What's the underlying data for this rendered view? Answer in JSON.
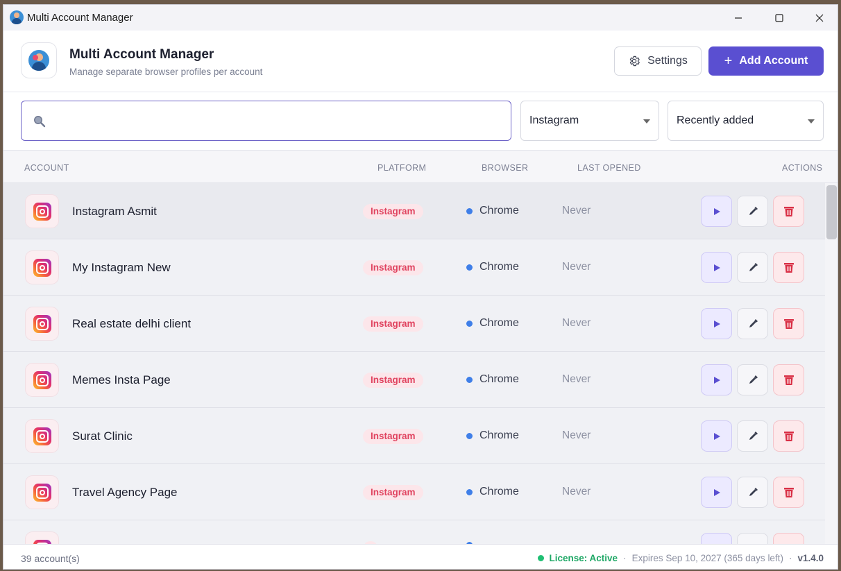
{
  "window": {
    "title": "Multi Account Manager"
  },
  "header": {
    "title": "Multi Account Manager",
    "subtitle": "Manage separate browser profiles per account",
    "settings_label": "Settings",
    "add_label": "Add Account",
    "add_icon": "+"
  },
  "filters": {
    "search_value": "",
    "platform": "Instagram",
    "sort": "Recently added"
  },
  "table": {
    "columns": [
      "ACCOUNT",
      "PLATFORM",
      "BROWSER",
      "LAST OPENED",
      "ACTIONS"
    ],
    "rows": [
      {
        "name": "Instagram Asmit",
        "platform": "Instagram",
        "browser": "Chrome",
        "last_opened": "Never"
      },
      {
        "name": "My Instagram New",
        "platform": "Instagram",
        "browser": "Chrome",
        "last_opened": "Never"
      },
      {
        "name": "Real estate delhi client",
        "platform": "Instagram",
        "browser": "Chrome",
        "last_opened": "Never"
      },
      {
        "name": "Memes Insta Page",
        "platform": "Instagram",
        "browser": "Chrome",
        "last_opened": "Never"
      },
      {
        "name": "Surat Clinic",
        "platform": "Instagram",
        "browser": "Chrome",
        "last_opened": "Never"
      },
      {
        "name": "Travel Agency Page",
        "platform": "Instagram",
        "browser": "Chrome",
        "last_opened": "Never"
      },
      {
        "name": "",
        "platform": "",
        "browser": "",
        "last_opened": ""
      }
    ]
  },
  "footer": {
    "count": "39 account(s)",
    "license_label": "License: Active",
    "sep1": "·",
    "expires": "Expires Sep 10, 2027 (365 days left)",
    "sep2": "·",
    "version": "v1.4.0"
  },
  "colors": {
    "accent": "#5a4fd1",
    "instagram_pill": "#e0435f",
    "chrome_dot": "#3f7fe8",
    "license_green": "#1fbf73",
    "delete_red": "#e0435f"
  },
  "icons": [
    "app-logo-icon",
    "minimize-icon",
    "maximize-icon",
    "close-icon",
    "gear-icon",
    "plus-icon",
    "search-icon",
    "chevron-down-icon",
    "instagram-icon",
    "play-icon",
    "pencil-icon",
    "trash-icon"
  ]
}
